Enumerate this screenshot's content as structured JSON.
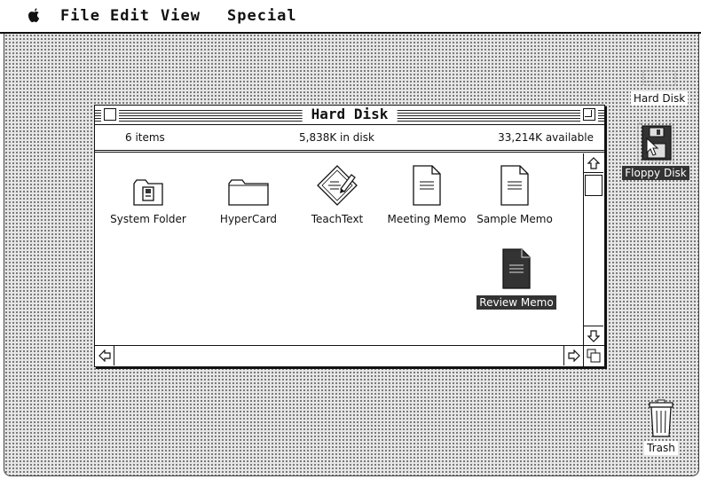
{
  "menubar": {
    "apple_icon": "apple-logo-icon",
    "menus": [
      "File",
      "Edit",
      "View",
      "Special"
    ]
  },
  "window": {
    "title": "Hard Disk",
    "info": {
      "items": "6 items",
      "used": "5,838K in disk",
      "available": "33,214K available"
    },
    "files": [
      {
        "name": "System Folder",
        "icon": "system-folder-icon",
        "selected": false
      },
      {
        "name": "HyperCard",
        "icon": "folder-icon",
        "selected": false
      },
      {
        "name": "TeachText",
        "icon": "teachtext-app-icon",
        "selected": false
      },
      {
        "name": "Meeting Memo",
        "icon": "document-icon",
        "selected": false
      },
      {
        "name": "Sample Memo",
        "icon": "document-icon",
        "selected": false
      },
      {
        "name": "Review Memo",
        "icon": "document-icon",
        "selected": true
      }
    ]
  },
  "desktop": {
    "icons": [
      {
        "name": "Hard Disk",
        "icon": "hard-disk-icon",
        "selected": false
      },
      {
        "name": "Floppy Disk",
        "icon": "floppy-disk-icon",
        "selected": true
      },
      {
        "name": "Trash",
        "icon": "trash-icon",
        "selected": false
      }
    ]
  },
  "colors": {
    "ink": "#111111",
    "paper": "#ffffff",
    "highlight": "#333333"
  }
}
